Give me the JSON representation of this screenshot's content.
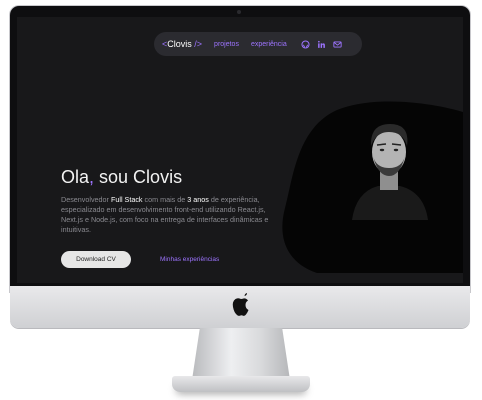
{
  "nav": {
    "logo_open": "<",
    "logo_name": "Clovis",
    "logo_close": " />",
    "links": [
      "projetos",
      "experiência"
    ],
    "icons": [
      "github-icon",
      "linkedin-icon",
      "mail-icon"
    ]
  },
  "hero": {
    "greeting": "Ola",
    "comma": ",",
    "name_text": " sou Clovis",
    "desc_part1": "Desenvolvedor ",
    "desc_bold1": "Full Stack",
    "desc_part2": " com mais de ",
    "desc_bold2": "3 anos",
    "desc_part3": " de experiência, especializado em desenvolvimento front-end utilizando React.js, Next.js e Node.js, com foco na entrega de interfaces dinâmicas e intuitivas.",
    "cv_button": "Download CV",
    "experience_link": "Minhas experiências"
  },
  "colors": {
    "accent": "#9d74ff",
    "background": "#18181a",
    "navbar": "#2b2b30"
  }
}
